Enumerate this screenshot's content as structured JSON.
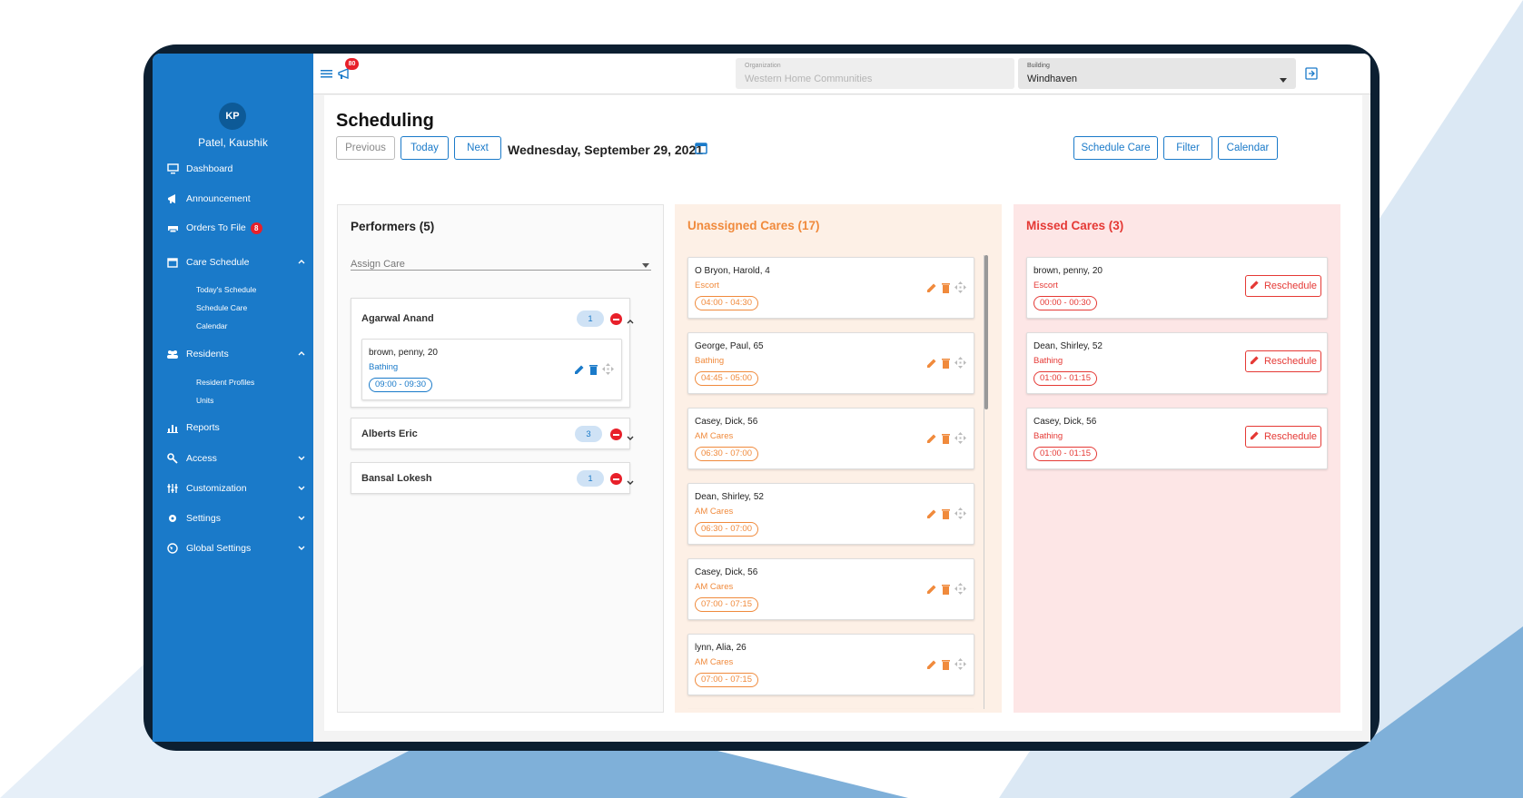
{
  "sidebar": {
    "avatar_initials": "KP",
    "user_name": "Patel, Kaushik",
    "items": {
      "dashboard": "Dashboard",
      "announcement": "Announcement",
      "orders": "Orders To File",
      "orders_badge": "8",
      "care_schedule": "Care Schedule",
      "todays_schedule": "Today's Schedule",
      "schedule_care": "Schedule Care",
      "calendar": "Calendar",
      "residents": "Residents",
      "resident_profiles": "Resident Profiles",
      "units": "Units",
      "reports": "Reports",
      "access": "Access",
      "customization": "Customization",
      "settings": "Settings",
      "global_settings": "Global Settings"
    }
  },
  "topbar": {
    "notification_count": "80",
    "organization_label": "Organization",
    "organization_value": "Western Home Communities",
    "building_label": "Building",
    "building_value": "Windhaven"
  },
  "page": {
    "title": "Scheduling",
    "previous": "Previous",
    "today": "Today",
    "next": "Next",
    "date": "Wednesday, September 29, 2021",
    "schedule_care": "Schedule Care",
    "filter": "Filter",
    "calendar": "Calendar"
  },
  "performers": {
    "title": "Performers (5)",
    "assign_placeholder": "Assign Care",
    "list": [
      {
        "name": "Agarwal Anand",
        "count": "1",
        "card": {
          "name": "brown, penny, 20",
          "type": "Bathing",
          "time": "09:00 - 09:30"
        }
      },
      {
        "name": "Alberts Eric",
        "count": "3"
      },
      {
        "name": "Bansal Lokesh",
        "count": "1"
      }
    ]
  },
  "unassigned": {
    "title": "Unassigned Cares (17)",
    "cards": [
      {
        "name": "O Bryon, Harold, 4",
        "type": "Escort",
        "time": "04:00 - 04:30"
      },
      {
        "name": "George, Paul, 65",
        "type": "Bathing",
        "time": "04:45 - 05:00"
      },
      {
        "name": "Casey, Dick, 56",
        "type": "AM Cares",
        "time": "06:30 - 07:00"
      },
      {
        "name": "Dean, Shirley, 52",
        "type": "AM Cares",
        "time": "06:30 - 07:00"
      },
      {
        "name": "Casey, Dick, 56",
        "type": "AM Cares",
        "time": "07:00 - 07:15"
      },
      {
        "name": "lynn, Alia, 26",
        "type": "AM Cares",
        "time": "07:00 - 07:15"
      }
    ]
  },
  "missed": {
    "title": "Missed Cares (3)",
    "reschedule": "Reschedule",
    "cards": [
      {
        "name": "brown, penny, 20",
        "type": "Escort",
        "time": "00:00 - 00:30"
      },
      {
        "name": "Dean, Shirley, 52",
        "type": "Bathing",
        "time": "01:00 - 01:15"
      },
      {
        "name": "Casey, Dick, 56",
        "type": "Bathing",
        "time": "01:00 - 01:15"
      }
    ]
  },
  "colors": {
    "sidebar": "#1a7ac9",
    "unassigned_bg": "#fdf0e6",
    "unassigned_accent": "#f08a3c",
    "missed_bg": "#fde6e6",
    "missed_accent": "#e53935"
  }
}
